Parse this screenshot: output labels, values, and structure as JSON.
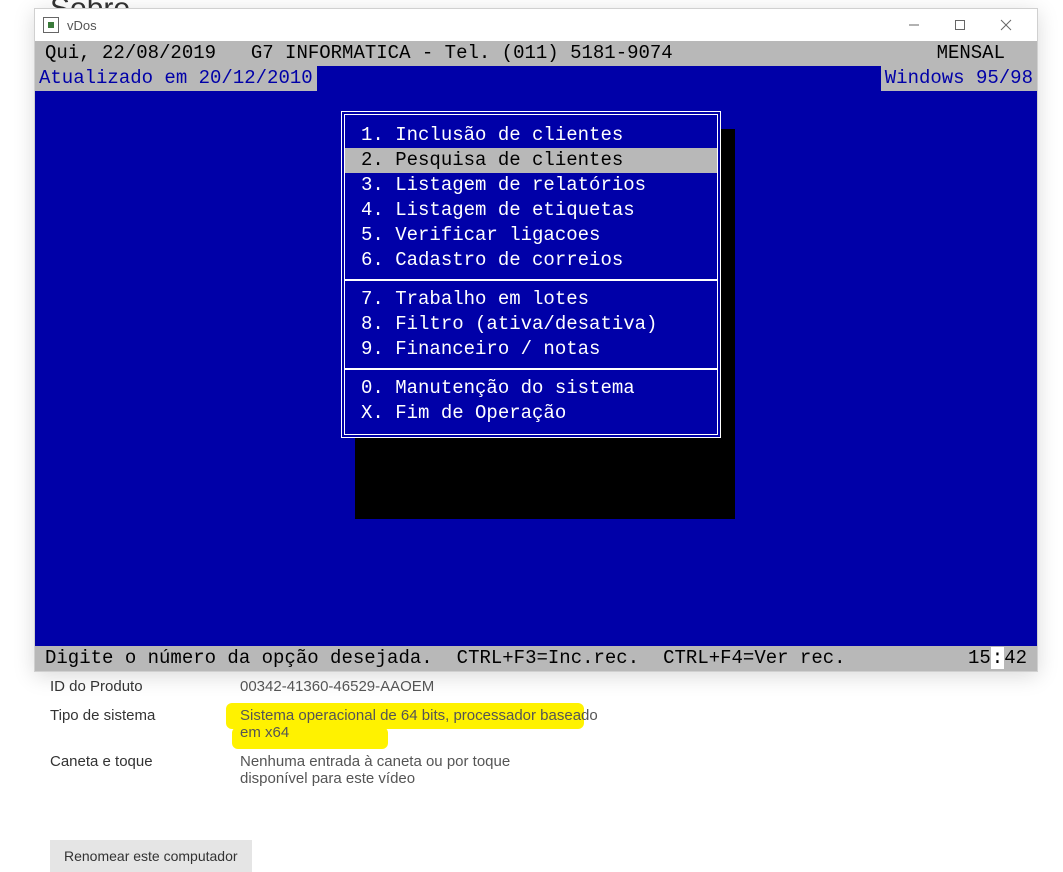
{
  "background": {
    "heading": "Sobre"
  },
  "window": {
    "title": "vDos"
  },
  "dos": {
    "topbar": {
      "date": "Qui, 22/08/2019",
      "company": "G7 INFORMATICA - Tel. (011) 5181-9074",
      "mode": "MENSAL"
    },
    "second": {
      "updated": "Atualizado em 20/12/2010",
      "os": "Windows 95/98"
    },
    "menu": {
      "group1": [
        {
          "key": "1",
          "label": "Inclusão de clientes",
          "selected": false
        },
        {
          "key": "2",
          "label": "Pesquisa de clientes",
          "selected": true
        },
        {
          "key": "3",
          "label": "Listagem de relatórios",
          "selected": false
        },
        {
          "key": "4",
          "label": "Listagem de etiquetas",
          "selected": false
        },
        {
          "key": "5",
          "label": "Verificar ligacoes",
          "selected": false
        },
        {
          "key": "6",
          "label": "Cadastro de correios",
          "selected": false
        }
      ],
      "group2": [
        {
          "key": "7",
          "label": "Trabalho em lotes"
        },
        {
          "key": "8",
          "label": "Filtro (ativa/desativa)"
        },
        {
          "key": "9",
          "label": "Financeiro / notas"
        }
      ],
      "group3": [
        {
          "key": "0",
          "label": "Manutenção do sistema"
        },
        {
          "key": "X",
          "label": "Fim de Operação"
        }
      ]
    },
    "bottombar": {
      "prompt": "Digite o número da opção desejada.",
      "help1": "CTRL+F3=Inc.rec.",
      "help2": "CTRL+F4=Ver rec.",
      "time_h": "15",
      "time_m": "42"
    }
  },
  "sysinfo": {
    "rows": [
      {
        "label": "ID do Produto",
        "value": "00342-41360-46529-AAOEM",
        "highlight": false
      },
      {
        "label": "Tipo de sistema",
        "value": "Sistema operacional de 64 bits, processador baseado em x64",
        "highlight": true
      },
      {
        "label": "Caneta e toque",
        "value": "Nenhuma entrada à caneta ou por toque disponível para este vídeo",
        "highlight": false
      }
    ],
    "rename_button": "Renomear este computador"
  }
}
